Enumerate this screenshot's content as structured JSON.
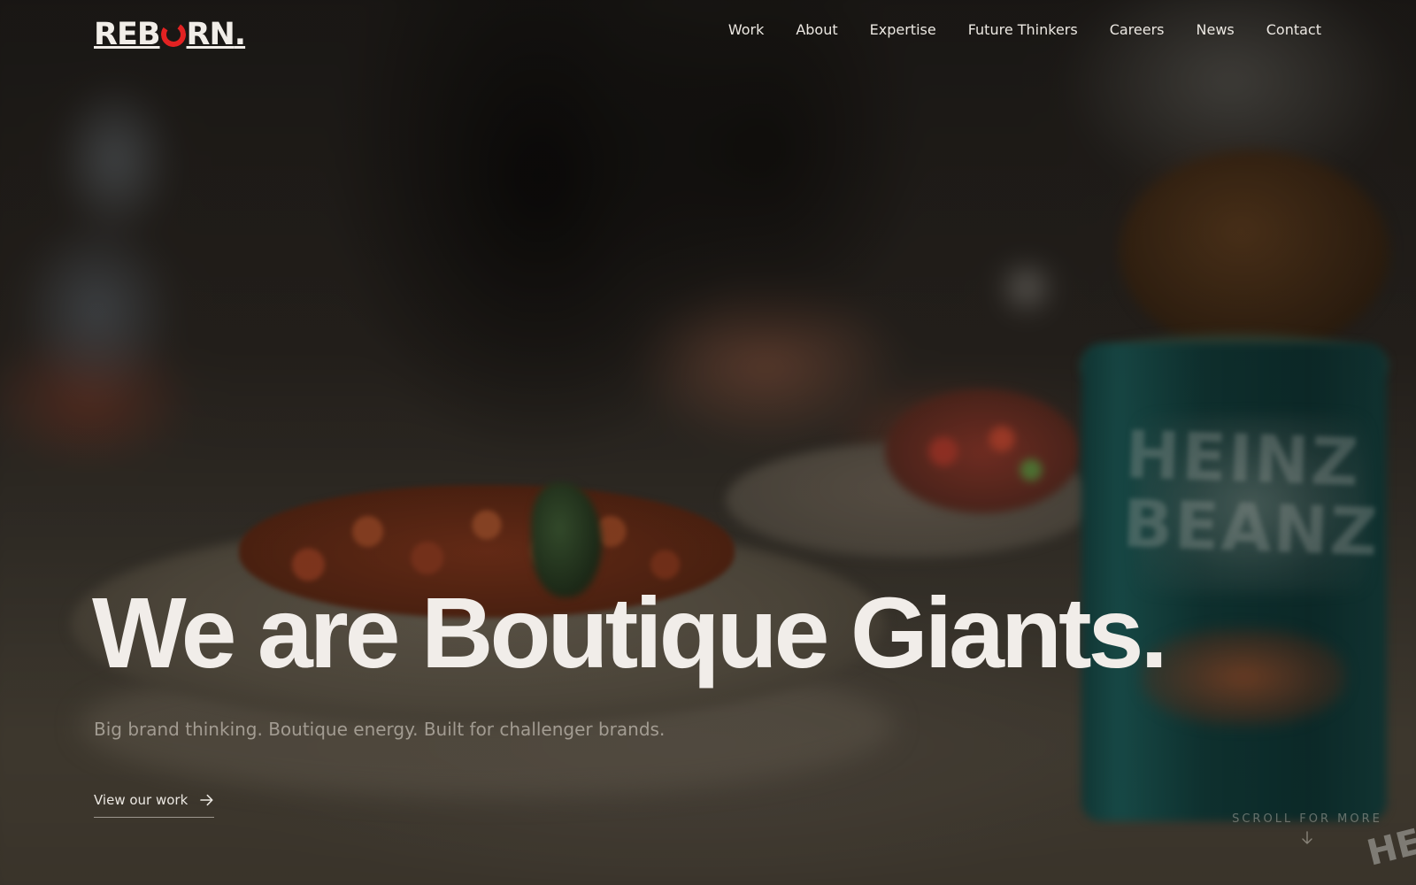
{
  "brand": {
    "logo_prefix": "REB",
    "logo_suffix": "RN",
    "logo_dot": ".",
    "accent_color": "#e32222"
  },
  "nav": {
    "items": [
      "Work",
      "About",
      "Expertise",
      "Future Thinkers",
      "Careers",
      "News",
      "Contact"
    ]
  },
  "hero": {
    "title": "We are Boutique Giants.",
    "subtitle": "Big brand thinking. Boutique energy. Built for challenger brands.",
    "cta_label": "View our work",
    "cta_icon": "arrow-right-icon",
    "scroll_label": "SCROLL FOR MORE",
    "scroll_icon": "arrow-down-icon"
  }
}
